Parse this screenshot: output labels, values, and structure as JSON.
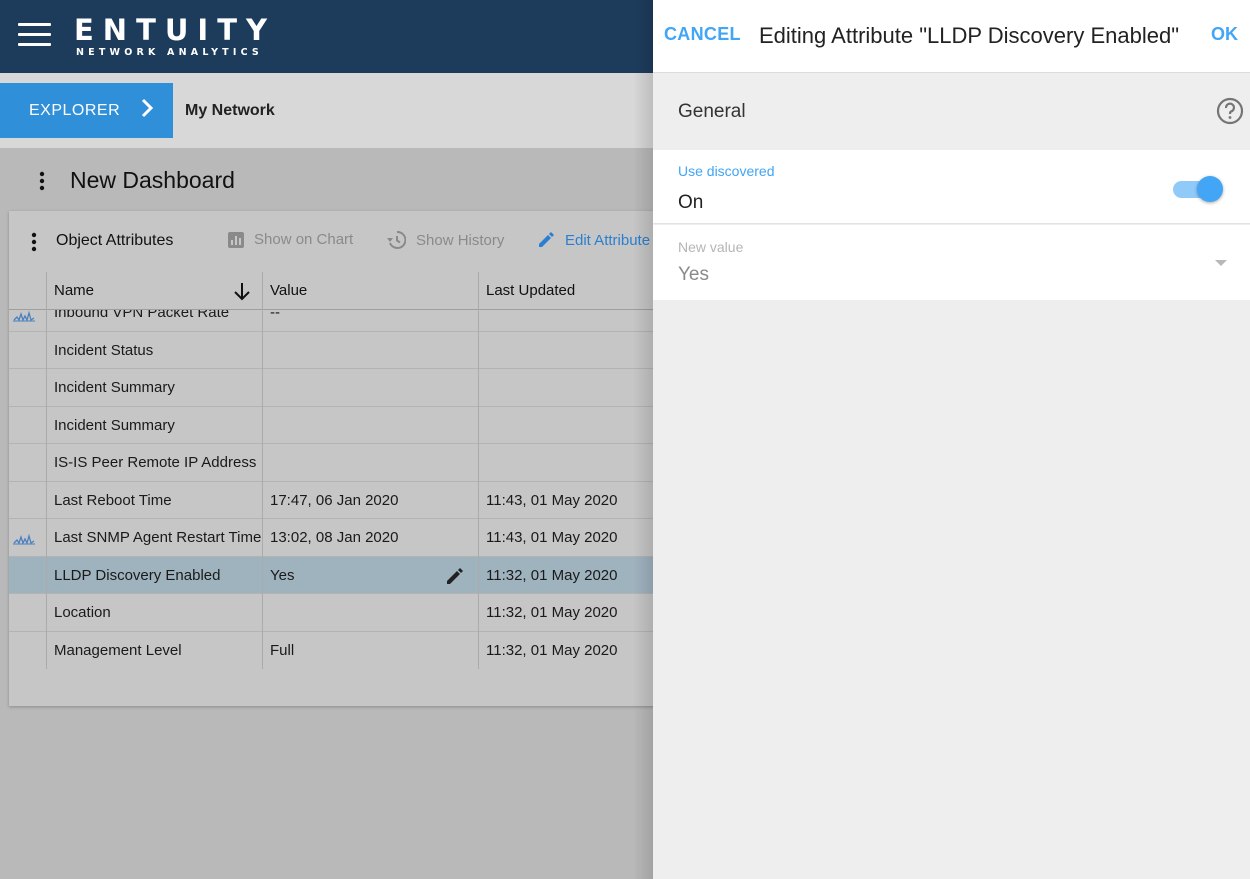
{
  "header": {
    "logo_main": "ENTUITY",
    "logo_sub": "NETWORK ANALYTICS"
  },
  "breadcrumb": {
    "explorer_label": "EXPLORER",
    "current": "My Network"
  },
  "dashboard": {
    "title": "New Dashboard"
  },
  "card": {
    "title": "Object Attributes",
    "toolbar": {
      "show_on_chart": "Show on Chart",
      "show_history": "Show History",
      "edit_attribute": "Edit Attribute"
    },
    "columns": [
      "Name",
      "Value",
      "Last Updated"
    ],
    "rows": [
      {
        "icon": true,
        "name": "Inbound VPN Packet Rate",
        "value": "--",
        "updated": ""
      },
      {
        "icon": false,
        "name": "Incident Status",
        "value": "",
        "updated": ""
      },
      {
        "icon": false,
        "name": "Incident Summary",
        "value": "",
        "updated": ""
      },
      {
        "icon": false,
        "name": "Incident Summary",
        "value": "",
        "updated": ""
      },
      {
        "icon": false,
        "name": "IS-IS Peer Remote IP Address",
        "value": "",
        "updated": ""
      },
      {
        "icon": false,
        "name": "Last Reboot Time",
        "value": "17:47, 06 Jan 2020",
        "updated": "11:43, 01 May 2020"
      },
      {
        "icon": true,
        "name": "Last SNMP Agent Restart Time",
        "value": "13:02, 08 Jan 2020",
        "updated": "11:43, 01 May 2020"
      },
      {
        "icon": false,
        "name": "LLDP Discovery Enabled",
        "value": "Yes",
        "updated": "11:32, 01 May 2020",
        "selected": true
      },
      {
        "icon": false,
        "name": "Location",
        "value": "",
        "updated": "11:32, 01 May 2020"
      },
      {
        "icon": false,
        "name": "Management Level",
        "value": "Full",
        "updated": "11:32, 01 May 2020"
      }
    ]
  },
  "panel": {
    "cancel_label": "CANCEL",
    "title": "Editing Attribute \"LLDP Discovery Enabled\"",
    "ok_label": "OK",
    "section_title": "General",
    "use_discovered": {
      "label": "Use discovered",
      "value": "On",
      "toggle_on": true
    },
    "new_value": {
      "label": "New value",
      "value": "Yes"
    }
  },
  "colors": {
    "header_bg": "#1d3c5c",
    "accent": "#42a5f5",
    "explorer_bg": "#2f8fd9",
    "selected_row": "#9fb3bf"
  }
}
